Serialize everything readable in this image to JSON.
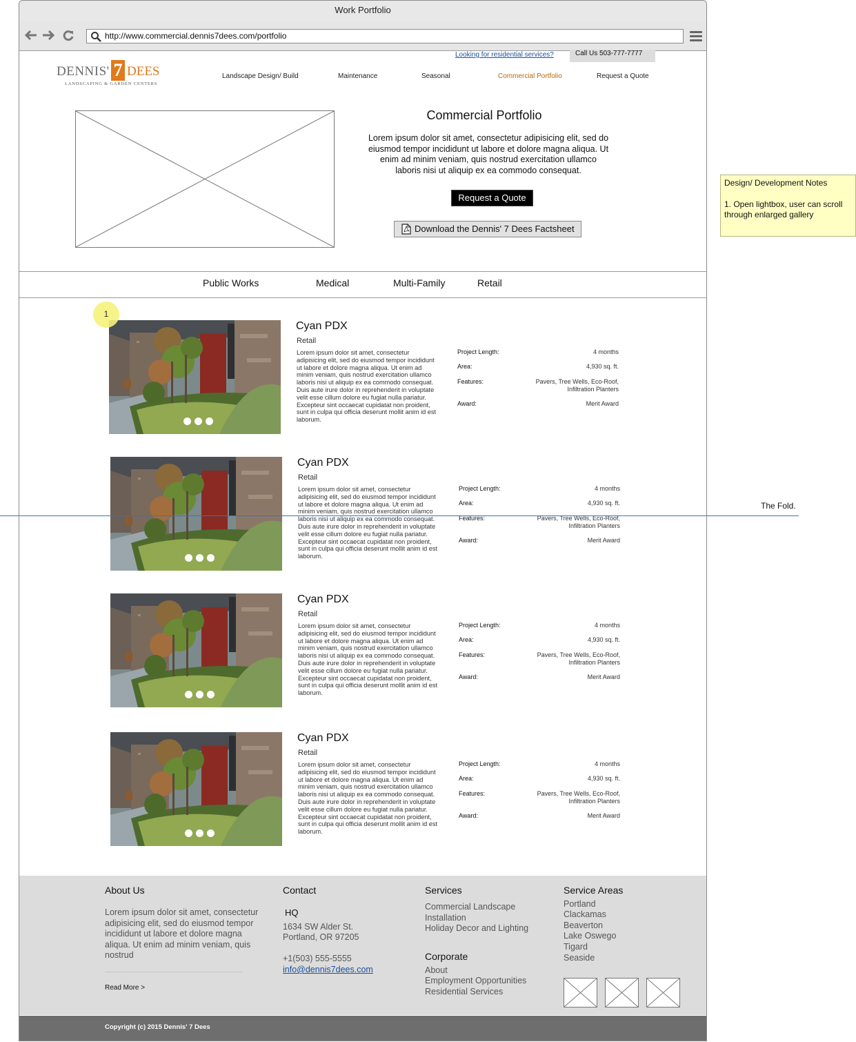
{
  "browser": {
    "title": "Work Portfolio",
    "url": "http://www.commercial.dennis7dees.com/portfolio"
  },
  "header": {
    "logo": {
      "name": "DENNIS'",
      "seven": "7",
      "dees": "DEES",
      "tagline": "LANDSCAPING & GARDEN CENTERS"
    },
    "residential_link": "Looking for residential services?",
    "call": "Call Us 503-777-7777",
    "nav": [
      "Landscape Design/ Build",
      "Maintenance",
      "Seasonal",
      "Commercial Portfolio",
      "Request a Quote"
    ],
    "active_nav": "Commercial Portfolio"
  },
  "hero": {
    "title": "Commercial Portfolio",
    "text": "Lorem ipsum dolor sit amet, consectetur adipisicing elit, sed do eiusmod tempor incididunt ut labore et dolore magna aliqua. Ut enim ad minim veniam, quis nostrud exercitation ullamco laboris nisi ut aliquip ex ea commodo consequat.",
    "quote_button": "Request a Quote",
    "factsheet_button": "Download the Dennis' 7 Dees Factsheet"
  },
  "categories": [
    "Public Works",
    "Medical",
    "Multi-Family",
    "Retail"
  ],
  "projects": [
    {
      "title": "Cyan PDX",
      "category": "Retail",
      "description": "Lorem ipsum dolor sit amet, consectetur adipisicing elit, sed do eiusmod tempor incididunt ut labore et dolore magna aliqua. Ut enim ad minim veniam, quis nostrud exercitation ullamco laboris nisi ut aliquip ex ea commodo consequat. Duis aute irure dolor in reprehenderit in voluptate velit esse cillum dolore eu fugiat nulla pariatur. Excepteur sint occaecat cupidatat non proident, sunt in culpa qui officia deserunt mollit anim id est laborum.",
      "length_label": "Project Length:",
      "length": "4 months",
      "area_label": "Area:",
      "area": "4,930 sq. ft.",
      "features_label": "Features:",
      "features_1": "Pavers, Tree Wells, Eco-Roof,",
      "features_2": "Infiltration Planters",
      "award_label": "Award:",
      "award": "Merit Award"
    },
    {
      "title": "Cyan PDX",
      "category": "Retail",
      "description": "Lorem ipsum dolor sit amet, consectetur adipisicing elit, sed do eiusmod tempor incididunt ut labore et dolore magna aliqua. Ut enim ad minim veniam, quis nostrud exercitation ullamco laboris nisi ut aliquip ex ea commodo consequat. Duis aute irure dolor in reprehenderit in voluptate velit esse cillum dolore eu fugiat nulla pariatur. Excepteur sint occaecat cupidatat non proident, sunt in culpa qui officia deserunt mollit anim id est laborum.",
      "length_label": "Project Length:",
      "length": "4 months",
      "area_label": "Area:",
      "area": "4,930 sq. ft.",
      "features_label": "Features:",
      "features_1": "Pavers, Tree Wells, Eco-Roof,",
      "features_2": "Infiltration Planters",
      "award_label": "Award:",
      "award": "Merit Award"
    },
    {
      "title": "Cyan PDX",
      "category": "Retail",
      "description": "Lorem ipsum dolor sit amet, consectetur adipisicing elit, sed do eiusmod tempor incididunt ut labore et dolore magna aliqua. Ut enim ad minim veniam, quis nostrud exercitation ullamco laboris nisi ut aliquip ex ea commodo consequat. Duis aute irure dolor in reprehenderit in voluptate velit esse cillum dolore eu fugiat nulla pariatur. Excepteur sint occaecat cupidatat non proident, sunt in culpa qui officia deserunt mollit anim id est laborum.",
      "length_label": "Project Length:",
      "length": "4 months",
      "area_label": "Area:",
      "area": "4,930 sq. ft.",
      "features_label": "Features:",
      "features_1": "Pavers, Tree Wells, Eco-Roof,",
      "features_2": "Infiltration Planters",
      "award_label": "Award:",
      "award": "Merit Award"
    },
    {
      "title": "Cyan PDX",
      "category": "Retail",
      "description": "Lorem ipsum dolor sit amet, consectetur adipisicing elit, sed do eiusmod tempor incididunt ut labore et dolore magna aliqua. Ut enim ad minim veniam, quis nostrud exercitation ullamco laboris nisi ut aliquip ex ea commodo consequat. Duis aute irure dolor in reprehenderit in voluptate velit esse cillum dolore eu fugiat nulla pariatur. Excepteur sint occaecat cupidatat non proident, sunt in culpa qui officia deserunt mollit anim id est laborum.",
      "length_label": "Project Length:",
      "length": "4 months",
      "area_label": "Area:",
      "area": "4,930 sq. ft.",
      "features_label": "Features:",
      "features_1": "Pavers, Tree Wells, Eco-Roof,",
      "features_2": "Infiltration Planters",
      "award_label": "Award:",
      "award": "Merit Award"
    }
  ],
  "annotations": {
    "marker": "1",
    "notes_title": "Design/ Development Notes",
    "notes_item": "1. Open lightbox, user can scroll through enlarged gallery",
    "fold": "The Fold."
  },
  "footer": {
    "about": {
      "heading": "About Us",
      "text": "Lorem ipsum dolor sit amet, consectetur adipisicing elit, sed do eiusmod tempor incididunt ut labore et dolore magna aliqua. Ut enim ad minim veniam, quis nostrud",
      "read_more": "Read More >"
    },
    "contact": {
      "heading": "Contact",
      "hq": "HQ",
      "address_1": "1634 SW Alder St.",
      "address_2": "Portland, OR 97205",
      "phone": "+1(503) 555-5555",
      "email": "info@dennis7dees.com"
    },
    "services": {
      "heading": "Services",
      "items": [
        "Commercial Landscape Installation",
        "Holiday Decor and Lighting"
      ]
    },
    "corporate": {
      "heading": "Corporate",
      "items": [
        "About",
        "Employment Opportunities",
        "Residential Services"
      ]
    },
    "areas": {
      "heading": "Service Areas",
      "items": [
        "Portland",
        "Clackamas",
        "Beaverton",
        "Lake Oswego",
        "Tigard",
        "Seaside"
      ]
    },
    "copyright": "Copyright (c) 2015 Dennis' 7 Dees"
  },
  "colors": {
    "accent": "#e07a1a",
    "active_nav": "#b86a0c",
    "link": "#1a4f9c",
    "fold": "#3a6fc6",
    "footer": "#dcdcdc",
    "note": "#ffffc4"
  }
}
